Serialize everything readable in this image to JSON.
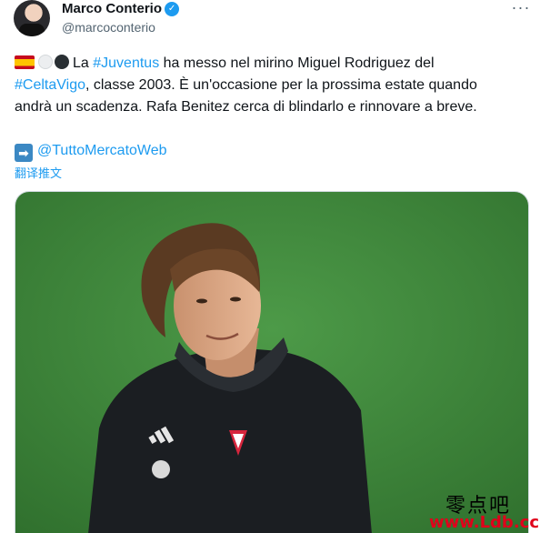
{
  "author": {
    "name": "Marco Conterio",
    "handle": "@marcoconterio",
    "verified": true
  },
  "more_icon": "more-horizontal-icon",
  "tweet": {
    "line1_emojis": [
      "spain-flag",
      "white-circle",
      "black-circle"
    ],
    "line1_prefix": "La ",
    "hashtag_juventus": "#Juventus",
    "line1_suffix": " ha messo nel mirino Miguel Rodriguez del",
    "hashtag_celtavigo": "#CeltaVigo",
    "line2_suffix": ", classe 2003. È un'occasione per la prossima estate quando",
    "line3": "andrà un scadenza. Rafa Benitez cerca di blindarlo e rinnovare a breve.",
    "source_emoji": "right-arrow",
    "source_mention": "@TuttoMercatoWeb"
  },
  "translate_label": "翻译推文",
  "media": {
    "description_icon": "player-photo"
  },
  "watermark": {
    "chinese": "零点吧",
    "url": "www.Ldb.cc"
  },
  "colors": {
    "link": "#1d9bf0",
    "text": "#0f1419",
    "muted": "#536471",
    "pitch": "#3f8a3c"
  }
}
